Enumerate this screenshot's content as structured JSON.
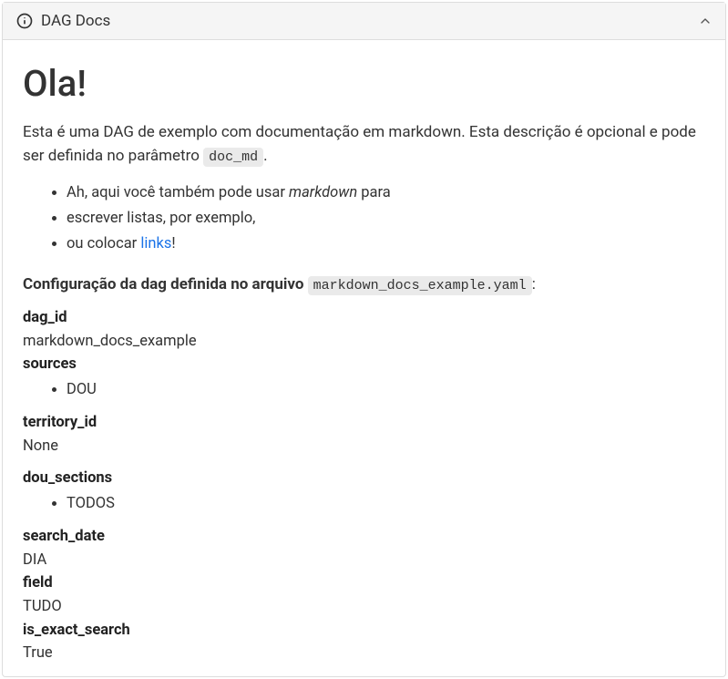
{
  "header": {
    "title": "DAG Docs"
  },
  "doc": {
    "heading": "Ola!",
    "intro_prefix": "Esta é uma DAG de exemplo com documentação em markdown. Esta descrição é opcional e pode ser definida no parâmetro ",
    "intro_code": "doc_md",
    "intro_suffix": ".",
    "bullets": {
      "b1_prefix": "Ah, aqui você também pode usar ",
      "b1_em": "markdown",
      "b1_suffix": " para",
      "b2": "escrever listas, por exemplo,",
      "b3_prefix": "ou colocar ",
      "b3_link": "links",
      "b3_suffix": "!"
    },
    "config_label_prefix": "Configuração da dag definida no arquivo ",
    "config_label_code": "markdown_docs_example.yaml",
    "config_label_suffix": ":",
    "config": {
      "dag_id": {
        "key": "dag_id",
        "value": "markdown_docs_example"
      },
      "sources": {
        "key": "sources",
        "items": [
          "DOU"
        ]
      },
      "territory_id": {
        "key": "territory_id",
        "value": "None"
      },
      "dou_sections": {
        "key": "dou_sections",
        "items": [
          "TODOS"
        ]
      },
      "search_date": {
        "key": "search_date",
        "value": "DIA"
      },
      "field": {
        "key": "field",
        "value": "TUDO"
      },
      "is_exact_search": {
        "key": "is_exact_search",
        "value": "True"
      }
    }
  }
}
